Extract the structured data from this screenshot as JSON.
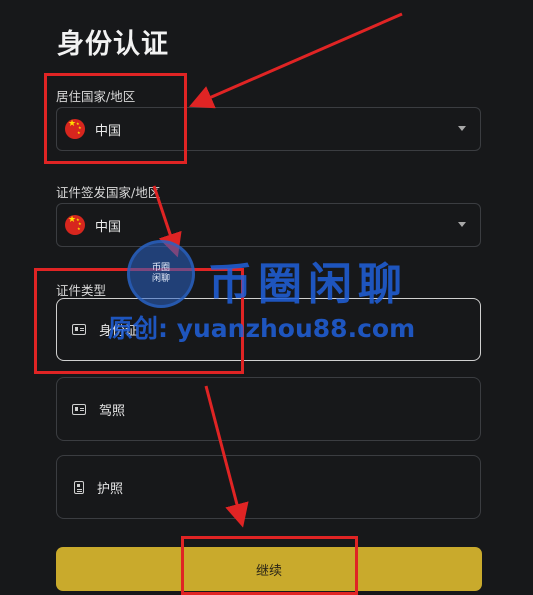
{
  "page": {
    "title": "身份认证"
  },
  "residence": {
    "label": "居住国家/地区",
    "value": "中国"
  },
  "issuing": {
    "label": "证件签发国家/地区",
    "value": "中国"
  },
  "doc_type": {
    "label": "证件类型",
    "options": [
      {
        "label": "身份证",
        "icon": "id-card-icon"
      },
      {
        "label": "驾照",
        "icon": "license-icon"
      },
      {
        "label": "护照",
        "icon": "passport-icon"
      }
    ]
  },
  "continue_label": "继续",
  "watermark": {
    "badge_top": "币圈",
    "badge_bottom": "闲聊",
    "brand": "币圈闲聊",
    "url": "原创: yuanzhou88.com"
  },
  "colors": {
    "annotation": "#e02424",
    "button": "#c9aa2c",
    "watermark": "#2060dc"
  }
}
